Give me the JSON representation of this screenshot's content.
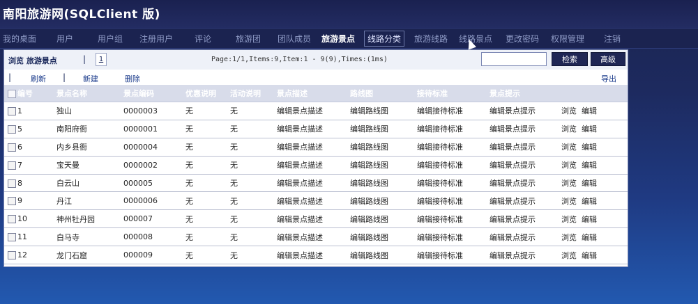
{
  "app": {
    "title": "南阳旅游网(SQLClient  版)"
  },
  "nav": {
    "items": [
      {
        "label": "我的桌面"
      },
      {
        "label": "用户"
      },
      {
        "label": "用户组"
      },
      {
        "label": "注册用户"
      },
      {
        "label": "评论"
      },
      {
        "label": "旅游团"
      },
      {
        "label": "团队成员"
      },
      {
        "label": "旅游景点"
      },
      {
        "label": "线路分类"
      },
      {
        "label": "旅游线路"
      },
      {
        "label": "线路景点"
      },
      {
        "label": "更改密码"
      },
      {
        "label": "权限管理"
      },
      {
        "label": "注销"
      }
    ]
  },
  "toolbar": {
    "crumb": "浏览  旅游景点",
    "separator": "|",
    "page_number": "1",
    "page_info": "Page:1/1,Items:9,Item:1 - 9(9),Times:(1ms)",
    "search_value": "",
    "search_button": "检索",
    "advanced_button": "高级",
    "refresh": "刷新",
    "new": "新建",
    "delete": "删除",
    "export": "导出"
  },
  "table": {
    "columns": [
      "编号",
      "景点名称",
      "景点编码",
      "优惠说明",
      "活动说明",
      "景点描述",
      "路线图",
      "接待标准",
      "景点提示",
      ""
    ],
    "rows": [
      {
        "id": "1",
        "name": "独山",
        "code": "0000003",
        "discount": "无",
        "activity": "无",
        "desc": "编辑景点描述",
        "route": "编辑路线图",
        "standard": "编辑接待标准",
        "tip": "编辑景点提示",
        "view": "浏览",
        "edit": "编辑"
      },
      {
        "id": "5",
        "name": "南阳府衙",
        "code": "0000001",
        "discount": "无",
        "activity": "无",
        "desc": "编辑景点描述",
        "route": "编辑路线图",
        "standard": "编辑接待标准",
        "tip": "编辑景点提示",
        "view": "浏览",
        "edit": "编辑"
      },
      {
        "id": "6",
        "name": "内乡县衙",
        "code": "0000004",
        "discount": "无",
        "activity": "无",
        "desc": "编辑景点描述",
        "route": "编辑路线图",
        "standard": "编辑接待标准",
        "tip": "编辑景点提示",
        "view": "浏览",
        "edit": "编辑"
      },
      {
        "id": "7",
        "name": "宝天曼",
        "code": "0000002",
        "discount": "无",
        "activity": "无",
        "desc": "编辑景点描述",
        "route": "编辑路线图",
        "standard": "编辑接待标准",
        "tip": "编辑景点提示",
        "view": "浏览",
        "edit": "编辑"
      },
      {
        "id": "8",
        "name": "白云山",
        "code": "000005",
        "discount": "无",
        "activity": "无",
        "desc": "编辑景点描述",
        "route": "编辑路线图",
        "standard": "编辑接待标准",
        "tip": "编辑景点提示",
        "view": "浏览",
        "edit": "编辑"
      },
      {
        "id": "9",
        "name": "丹江",
        "code": "0000006",
        "discount": "无",
        "activity": "无",
        "desc": "编辑景点描述",
        "route": "编辑路线图",
        "standard": "编辑接待标准",
        "tip": "编辑景点提示",
        "view": "浏览",
        "edit": "编辑"
      },
      {
        "id": "10",
        "name": "神州牡丹园",
        "code": "000007",
        "discount": "无",
        "activity": "无",
        "desc": "编辑景点描述",
        "route": "编辑路线图",
        "standard": "编辑接待标准",
        "tip": "编辑景点提示",
        "view": "浏览",
        "edit": "编辑"
      },
      {
        "id": "11",
        "name": "白马寺",
        "code": "000008",
        "discount": "无",
        "activity": "无",
        "desc": "编辑景点描述",
        "route": "编辑路线图",
        "standard": "编辑接待标准",
        "tip": "编辑景点提示",
        "view": "浏览",
        "edit": "编辑"
      },
      {
        "id": "12",
        "name": "龙门石窟",
        "code": "000009",
        "discount": "无",
        "activity": "无",
        "desc": "编辑景点描述",
        "route": "编辑路线图",
        "standard": "编辑接待标准",
        "tip": "编辑景点提示",
        "view": "浏览",
        "edit": "编辑"
      }
    ]
  }
}
